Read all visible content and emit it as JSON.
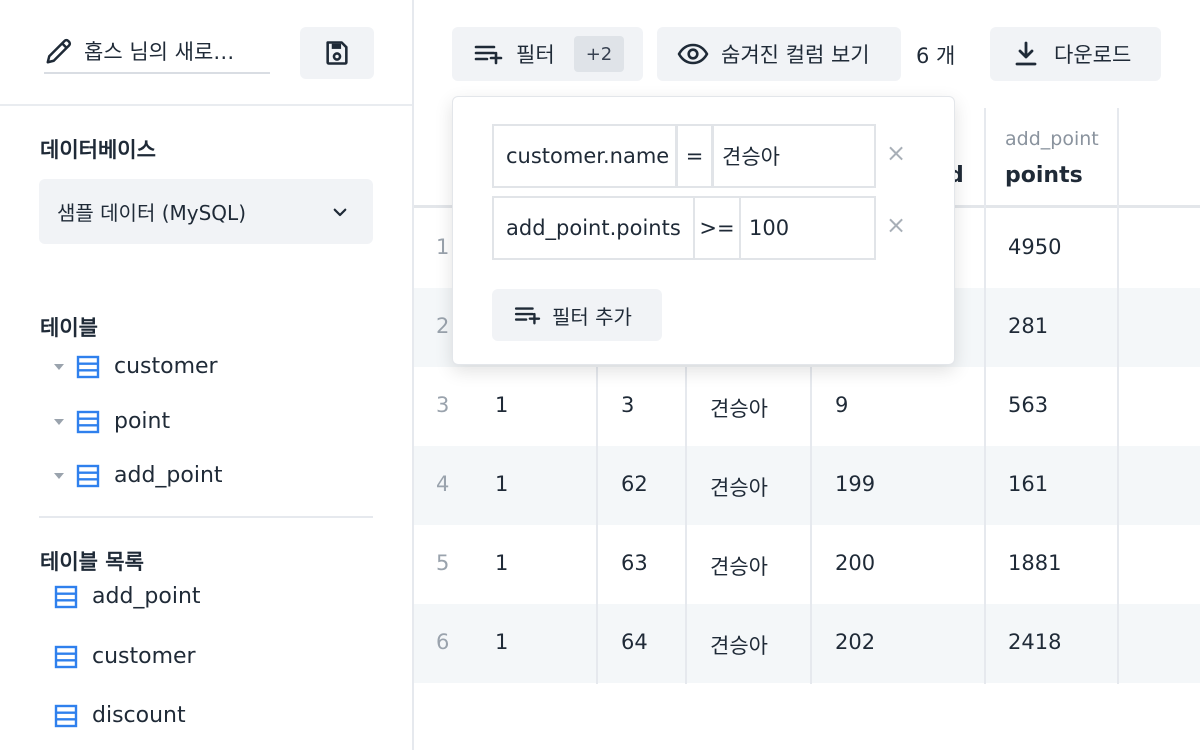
{
  "sidebar": {
    "query_title": "홉스 님의 새로…",
    "database_label": "데이터베이스",
    "database_selected": "샘플 데이터 (MySQL)",
    "tables_label": "테이블",
    "tables": [
      "customer",
      "point",
      "add_point"
    ],
    "table_list_label": "테이블 목록",
    "table_list": [
      "add_point",
      "customer",
      "discount"
    ]
  },
  "toolbar": {
    "filter_label": "필터",
    "filter_badge": "+2",
    "hidden_columns_label": "숨겨진 컬럼 보기",
    "row_count": "6 개",
    "download_label": "다운로드"
  },
  "table": {
    "header_partial": "d",
    "last_col_sub": "add_point",
    "last_col_main": "points",
    "rows": [
      {
        "idx": "1",
        "points": "4950"
      },
      {
        "idx": "2",
        "points": "281"
      },
      {
        "idx": "3",
        "c1": "1",
        "c2": "3",
        "name": "견승아",
        "c4": "9",
        "points": "563"
      },
      {
        "idx": "4",
        "c1": "1",
        "c2": "62",
        "name": "견승아",
        "c4": "199",
        "points": "161"
      },
      {
        "idx": "5",
        "c1": "1",
        "c2": "63",
        "name": "견승아",
        "c4": "200",
        "points": "1881"
      },
      {
        "idx": "6",
        "c1": "1",
        "c2": "64",
        "name": "견승아",
        "c4": "202",
        "points": "2418"
      }
    ]
  },
  "filter_popover": {
    "filters": [
      {
        "column": "customer.name",
        "operator": "=",
        "value": "견승아"
      },
      {
        "column": "add_point.points",
        "operator": ">=",
        "value": "100"
      }
    ],
    "close_glyph": "×",
    "add_filter_label": "필터 추가"
  },
  "colors": {
    "accent_blue": "#2f80ed",
    "button_bg": "#f1f3f6",
    "row_alt_bg": "#f4f7f9"
  }
}
